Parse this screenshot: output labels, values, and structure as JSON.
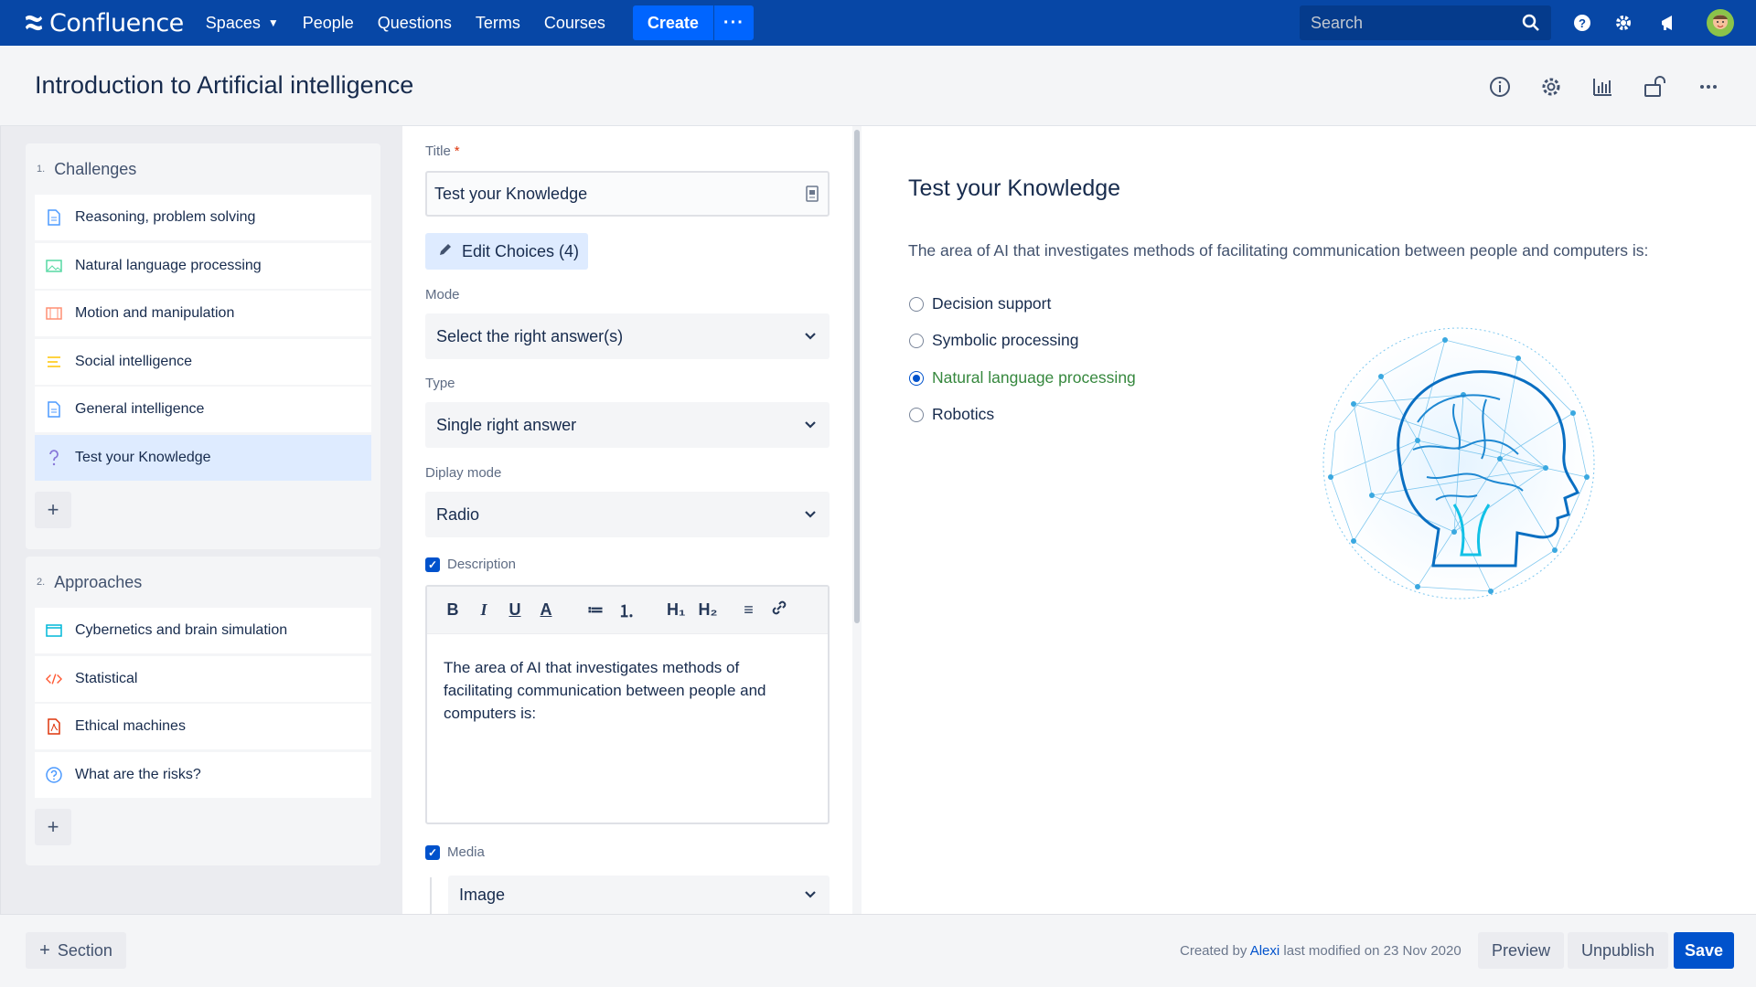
{
  "nav": {
    "brand": "Confluence",
    "items": [
      "Spaces",
      "People",
      "Questions",
      "Terms",
      "Courses"
    ],
    "create": "Create",
    "more": "···",
    "search_placeholder": "Search"
  },
  "page": {
    "title": "Introduction to Artificial intelligence"
  },
  "sidebar": {
    "sections": [
      {
        "num": "1.",
        "title": "Challenges",
        "items": [
          {
            "label": "Reasoning, problem solving",
            "icon": "document-icon"
          },
          {
            "label": "Natural language processing",
            "icon": "image-icon"
          },
          {
            "label": "Motion and manipulation",
            "icon": "video-icon"
          },
          {
            "label": "Social intelligence",
            "icon": "text-lines-icon"
          },
          {
            "label": "General intelligence",
            "icon": "document-icon"
          },
          {
            "label": "Test your Knowledge",
            "icon": "question-icon",
            "active": true
          }
        ],
        "plus": "+"
      },
      {
        "num": "2.",
        "title": "Approaches",
        "items": [
          {
            "label": "Cybernetics and brain simulation",
            "icon": "browser-icon"
          },
          {
            "label": "Statistical",
            "icon": "code-icon"
          },
          {
            "label": "Ethical machines",
            "icon": "pdf-icon"
          },
          {
            "label": "What are the risks?",
            "icon": "help-circle-icon"
          }
        ],
        "plus": "+"
      }
    ]
  },
  "form": {
    "title_label": "Title",
    "title_required": "*",
    "title_value": "Test your Knowledge",
    "edit_choices": "Edit Choices (4)",
    "mode_label": "Mode",
    "mode_value": "Select the right answer(s)",
    "type_label": "Type",
    "type_value": "Single right answer",
    "display_label": "Diplay mode",
    "display_value": "Radio",
    "description_label": "Description",
    "description_text": "The area of AI that investigates methods of facilitating communication between people and computers is:",
    "toolbar": [
      "B",
      "I",
      "U",
      "A",
      "≔",
      "⒈",
      "H₁",
      "H₂",
      "≡",
      "🔗"
    ],
    "media_label": "Media",
    "media_value": "Image"
  },
  "preview": {
    "title": "Test your Knowledge",
    "question": "The area of AI that investigates methods of facilitating communication between people and computers is:",
    "options": [
      {
        "label": "Decision support",
        "selected": false
      },
      {
        "label": "Symbolic processing",
        "selected": false
      },
      {
        "label": "Natural language processing",
        "selected": true
      },
      {
        "label": "Robotics",
        "selected": false
      }
    ]
  },
  "footer": {
    "section_button": "Section",
    "created_by_prefix": "Created by",
    "author": "Alexi",
    "modified_text": "last modified on 23 Nov 2020",
    "preview": "Preview",
    "unpublish": "Unpublish",
    "save": "Save"
  },
  "colors": {
    "nav": "#0747a6",
    "primary": "#0052cc",
    "selected_option": "#36883e"
  }
}
